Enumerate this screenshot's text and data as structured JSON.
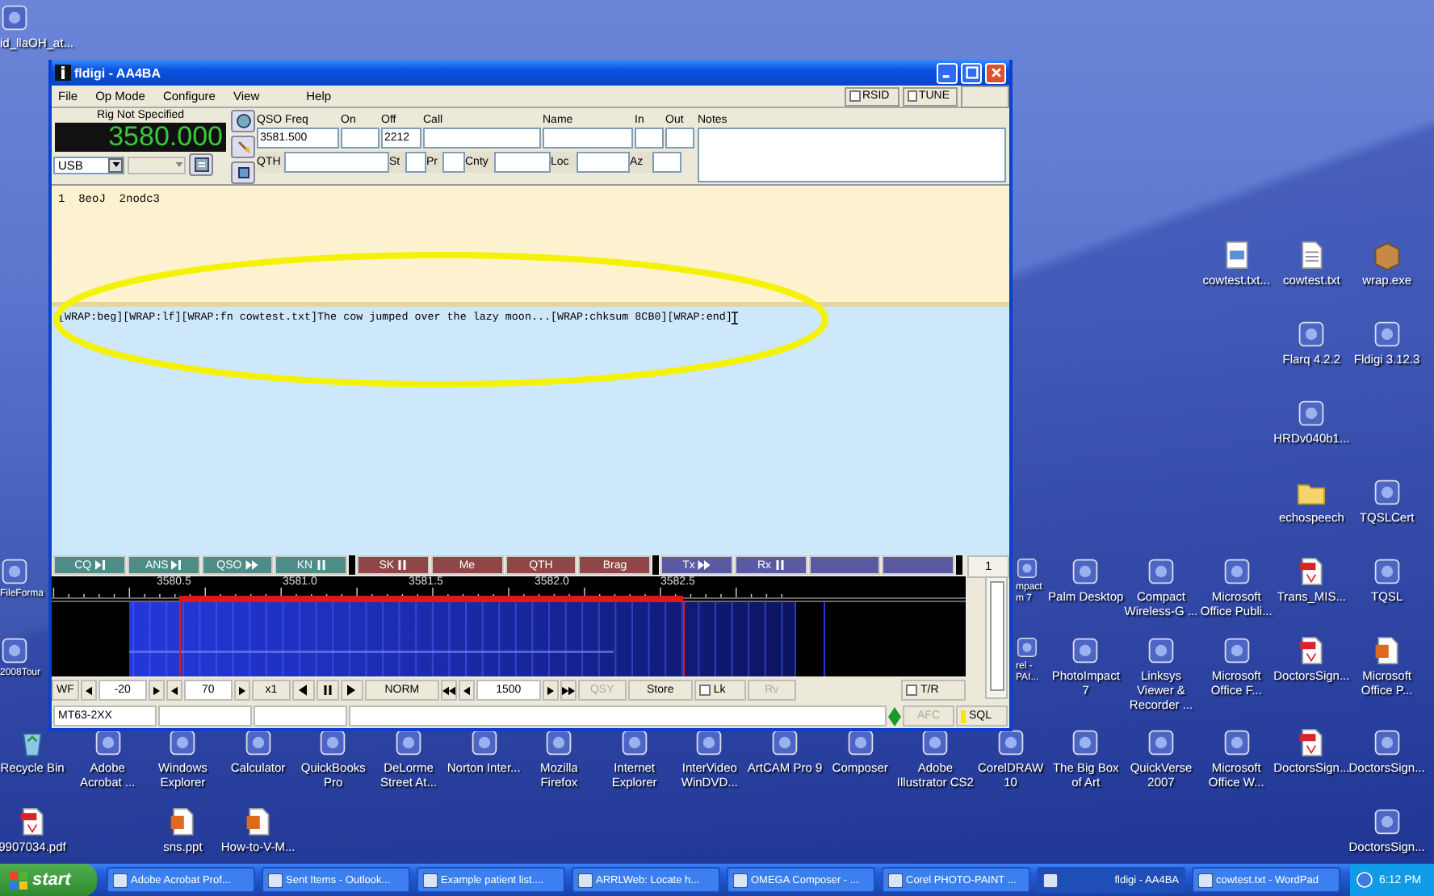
{
  "desktop_icons": [
    {
      "label": "id_llaOH_at...",
      "kind": "program"
    },
    {
      "label": "cowtest.txt...",
      "kind": "document"
    },
    {
      "label": "cowtest.txt",
      "kind": "text-file"
    },
    {
      "label": "wrap.exe",
      "kind": "package"
    },
    {
      "label": "Flarq 4.2.2",
      "kind": "program"
    },
    {
      "label": "Fldigi 3.12.3",
      "kind": "program"
    },
    {
      "label": "HRDv040b1...",
      "kind": "program"
    },
    {
      "label": "echospeech",
      "kind": "folder"
    },
    {
      "label": "TQSLCert",
      "kind": "program"
    },
    {
      "label": "FileForma",
      "kind": "program"
    },
    {
      "label": "mpact m 7",
      "kind": "program"
    },
    {
      "label": "Palm Desktop",
      "kind": "program"
    },
    {
      "label": "Compact Wireless-G ...",
      "kind": "program"
    },
    {
      "label": "Microsoft Office Publi...",
      "kind": "program"
    },
    {
      "label": "Trans_MIS...",
      "kind": "pdf"
    },
    {
      "label": "TQSL",
      "kind": "program"
    },
    {
      "label": "2008Tour",
      "kind": "program"
    },
    {
      "label": "rel -PAI...",
      "kind": "program"
    },
    {
      "label": "PhotoImpact 7",
      "kind": "program"
    },
    {
      "label": "Linksys Viewer & Recorder ...",
      "kind": "program"
    },
    {
      "label": "Microsoft Office F...",
      "kind": "program"
    },
    {
      "label": "DoctorsSign...",
      "kind": "pdf"
    },
    {
      "label": "Microsoft Office P...",
      "kind": "slides"
    },
    {
      "label": "Recycle Bin",
      "kind": "recycle-bin"
    },
    {
      "label": "Adobe Acrobat ...",
      "kind": "program"
    },
    {
      "label": "Windows Explorer",
      "kind": "program"
    },
    {
      "label": "Calculator",
      "kind": "program"
    },
    {
      "label": "QuickBooks Pro",
      "kind": "program"
    },
    {
      "label": "DeLorme Street At...",
      "kind": "program"
    },
    {
      "label": "Norton Inter...",
      "kind": "program"
    },
    {
      "label": "Mozilla Firefox",
      "kind": "program"
    },
    {
      "label": "Internet Explorer",
      "kind": "program"
    },
    {
      "label": "InterVideo WinDVD...",
      "kind": "program"
    },
    {
      "label": "ArtCAM Pro 9",
      "kind": "program"
    },
    {
      "label": "Composer",
      "kind": "program"
    },
    {
      "label": "Adobe Illustrator CS2",
      "kind": "program"
    },
    {
      "label": "CorelDRAW 10",
      "kind": "program"
    },
    {
      "label": "The Big Box of Art",
      "kind": "program"
    },
    {
      "label": "QuickVerse 2007",
      "kind": "program"
    },
    {
      "label": "Microsoft Office W...",
      "kind": "program"
    },
    {
      "label": "DoctorsSign...",
      "kind": "pdf"
    },
    {
      "label": "DoctorsSign...",
      "kind": "program"
    },
    {
      "label": "9907034.pdf",
      "kind": "pdf"
    },
    {
      "label": "sns.ppt",
      "kind": "slides"
    },
    {
      "label": "How-to-V-M...",
      "kind": "slides"
    },
    {
      "label": "DoctorsSign...",
      "kind": "program"
    }
  ],
  "window": {
    "title": "fldigi - AA4BA",
    "menu": [
      "File",
      "Op Mode",
      "Configure",
      "View",
      "Help"
    ],
    "toggles": [
      {
        "label": "RSID",
        "checked": false
      },
      {
        "label": "TUNE",
        "checked": false
      }
    ],
    "rig": {
      "name": "Rig Not Specified",
      "frequency": "3580.000",
      "mode": "USB"
    },
    "log_row_1": [
      {
        "label": "QSO Freq",
        "value": "3581.500"
      },
      {
        "label": "On"
      },
      {
        "label": "Off",
        "value": "2212"
      },
      {
        "label": "Call"
      },
      {
        "label": "Name"
      },
      {
        "label": "In"
      },
      {
        "label": "Out"
      }
    ],
    "notes_label": "Notes",
    "log_row_2": [
      {
        "label": "QTH"
      },
      {
        "label": "St"
      },
      {
        "label": "Pr"
      },
      {
        "label": "Cnty"
      },
      {
        "label": "Loc"
      },
      {
        "label": "Az"
      }
    ],
    "receive_text": "1  8eoJ  2nodc3",
    "transmit_text": "[WRAP:beg][WRAP:lf][WRAP:fn cowtest.txt]The cow jumped over the lazy moon...[WRAP:chksum 8CB0][WRAP:end]",
    "macros": [
      {
        "label": "CQ",
        "color": "#4e8d87"
      },
      {
        "label": "ANS",
        "color": "#4e8d87"
      },
      {
        "label": "QSO",
        "color": "#4e8d87"
      },
      {
        "label": "KN",
        "color": "#4e8d87"
      },
      {
        "label": "SK",
        "color": "#8e4746"
      },
      {
        "label": "Me",
        "color": "#8e4746"
      },
      {
        "label": "QTH",
        "color": "#8e4746"
      },
      {
        "label": "Brag",
        "color": "#8e4746"
      },
      {
        "label": "Tx",
        "color": "#5a5aa2"
      },
      {
        "label": "Rx",
        "color": "#5a5aa2"
      },
      {
        "color": "#5a5aa2"
      },
      {
        "color": "#5a5aa2"
      }
    ],
    "macro_bank": "1",
    "waterfall_scale": [
      "3580.5",
      "3581.0",
      "3581.5",
      "3582.0",
      "3582.5"
    ],
    "controls": {
      "display": "WF",
      "low": "-20",
      "range": "70",
      "zoom": "x1",
      "speed": "NORM",
      "carrier": "1500",
      "qsy": {
        "label": "QSY",
        "disabled": true
      },
      "store": {
        "label": "Store",
        "disabled": false
      },
      "lock": {
        "label": "Lk",
        "checked": false
      },
      "reverse": {
        "label": "Rv",
        "disabled": true
      },
      "tr": {
        "label": "T/R",
        "checked": false
      }
    },
    "status": {
      "mode": "MT63-2XX",
      "afc": {
        "label": "AFC",
        "disabled": true
      },
      "sql": {
        "label": "SQL",
        "on": true
      }
    }
  },
  "taskbar": {
    "start": "start",
    "tasks": [
      {
        "label": "Adobe Acrobat Prof...",
        "selected": false
      },
      {
        "label": "Sent Items - Outlook...",
        "selected": false
      },
      {
        "label": "Example patient list....",
        "selected": false
      },
      {
        "label": "ARRLWeb: Locate h...",
        "selected": false
      },
      {
        "label": "OMEGA Composer - ...",
        "selected": false
      },
      {
        "label": "Corel PHOTO-PAINT ...",
        "selected": false
      },
      {
        "label": "fldigi - AA4BA",
        "selected": true
      },
      {
        "label": "cowtest.txt - WordPad",
        "selected": false
      }
    ],
    "clock": "6:12 PM"
  }
}
